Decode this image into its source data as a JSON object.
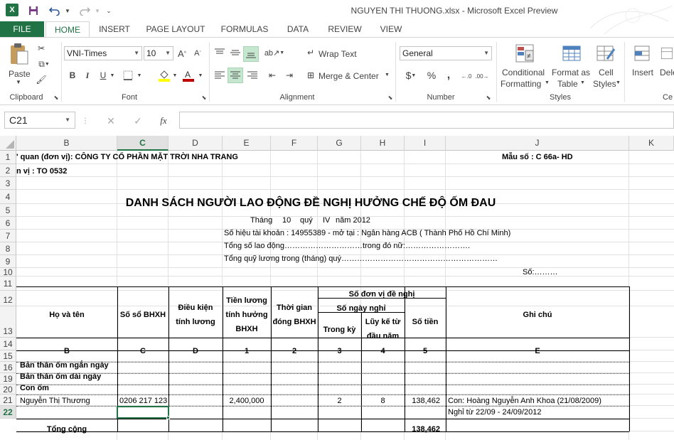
{
  "window": {
    "title": "NGUYEN THI THUONG.xlsx - Microsoft Excel Preview"
  },
  "colors": {
    "accent": "#217346",
    "highlight": "#c6e7cf"
  },
  "tabs": [
    "FILE",
    "HOME",
    "INSERT",
    "PAGE LAYOUT",
    "FORMULAS",
    "DATA",
    "REVIEW",
    "VIEW"
  ],
  "ribbon": {
    "clipboard": {
      "paste": "Paste",
      "label": "Clipboard"
    },
    "font": {
      "name": "VNI-Times",
      "size": "10",
      "bold": "B",
      "italic": "I",
      "underline": "U",
      "label": "Font"
    },
    "alignment": {
      "wrap": "Wrap Text",
      "merge": "Merge & Center",
      "label": "Alignment"
    },
    "number": {
      "format": "General",
      "label": "Number"
    },
    "styles": {
      "conditional": "Conditional",
      "conditional2": "Formatting",
      "format_as": "Format as",
      "format_as2": "Table",
      "cell": "Cell",
      "cell2": "Styles",
      "label": "Styles"
    },
    "cells": {
      "insert": "Insert",
      "delete": "Dele",
      "label": "Ce"
    }
  },
  "formula_bar": {
    "name_box": "C21",
    "fx": "fx"
  },
  "columns": [
    "B",
    "C",
    "D",
    "E",
    "F",
    "G",
    "H",
    "I",
    "J",
    "K"
  ],
  "rows": [
    "1",
    "2",
    "3",
    "4",
    "5",
    "6",
    "7",
    "8",
    "9",
    "10",
    "11",
    "12",
    "13",
    "14",
    "15",
    "16",
    "19",
    "20",
    "21",
    "22"
  ],
  "sheet": {
    "r1_left": "' quan (đơn vị): CÔNG TY CỔ PHẦN MẶT TRỜI NHA TRANG",
    "r1_right": "Mẫu số : C 66a- HD",
    "r2": "n vị : TO 0532",
    "r4": "DANH SÁCH NGƯỜI LAO ĐỘNG ĐỀ NGHỊ HƯỞNG CHẾ ĐỘ ỐM ĐAU",
    "r5_a": "Tháng",
    "r5_b": "10",
    "r5_c": "quý",
    "r5_d": "IV",
    "r5_e": "năm 2012",
    "r6": "Số hiệu tài khoản : 14955389  - mở tại : Ngân hàng ACB ( Thành Phố Hồ Chí Minh)",
    "r7": "Tổng số lao động…………………………trong đó nữ:…………………….",
    "r8": "Tổng quỹ lương trong (tháng) quý……………………………………………………",
    "r9": "Số:………",
    "headers": {
      "ho_ten": "Họ và tên",
      "so_so": "Số sổ BHXH",
      "dieu_kien_1": "Điều kiện",
      "dieu_kien_2": "tính lương",
      "tien_luong_1": "Tiền lương",
      "tien_luong_2": "tính hưởng",
      "tien_luong_3": "BHXH",
      "thoi_gian_1": "Thời gian",
      "thoi_gian_2": "đóng BHXH",
      "so_don_vi": "Số đơn vị đề nghị",
      "so_ngay_nghi": "Số ngày nghỉ",
      "trong_ky": "Trong kỳ",
      "luy_ke_1": "Lũy kế từ",
      "luy_ke_2": "đầu năm",
      "so_tien": "Số tiền",
      "ghi_chu": "Ghi chú"
    },
    "codes": [
      "B",
      "C",
      "D",
      "1",
      "2",
      "3",
      "4",
      "5",
      "E"
    ],
    "r15": "Bản thân ốm ngắn ngày",
    "r16": "Bản thân ốm dài ngày",
    "r19": "Con ốm",
    "r20": {
      "name": "Nguyễn Thị Thương",
      "so_so": "0206 217 123",
      "tien_luong": "2,400,000",
      "trong_ky": "2",
      "luy_ke": "8",
      "so_tien": "138,462",
      "ghi_chu": "Con: Hoàng Nguyễn Anh Khoa (21/08/2009)"
    },
    "r21": {
      "ghi_chu": "Nghỉ từ 22/09 - 24/09/2012"
    },
    "r22": {
      "label": "Tổng cộng",
      "so_tien": "138,462"
    }
  }
}
